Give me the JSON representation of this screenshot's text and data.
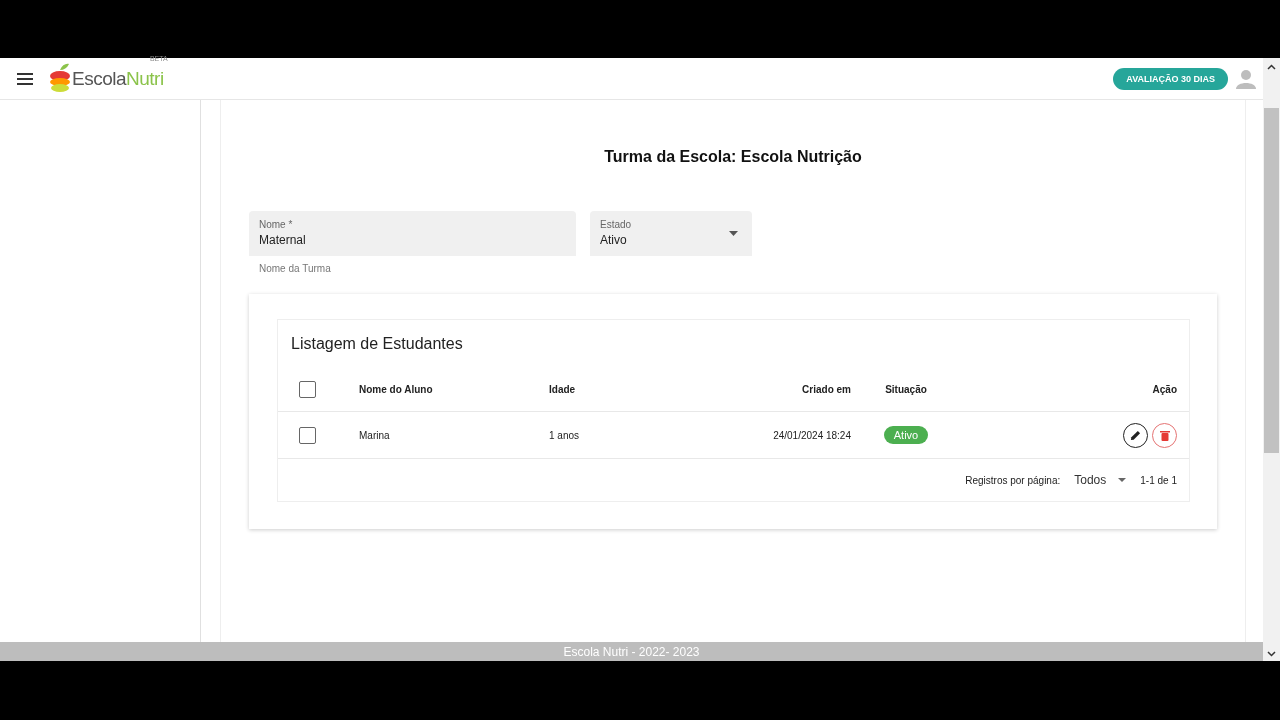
{
  "header": {
    "logo": {
      "name_part1": "Escola",
      "name_part2": "Nutri",
      "tag": "BETA"
    },
    "trial_button": "AVALIAÇÃO 30 DIAS"
  },
  "page_title": "Turma da Escola: Escola Nutrição",
  "form": {
    "name_field": {
      "label": "Nome *",
      "value": "Maternal",
      "helper": "Nome da Turma"
    },
    "status_select": {
      "label": "Estado",
      "value": "Ativo"
    }
  },
  "students": {
    "title": "Listagem de Estudantes",
    "select_all_checked": false,
    "columns": [
      {
        "label": "Nome do Aluno"
      },
      {
        "label": "Idade"
      },
      {
        "label": "Criado em"
      },
      {
        "label": "Situação"
      },
      {
        "label": "Ação"
      }
    ],
    "rows": [
      {
        "checked": false,
        "name": "Marina",
        "age": "1 anos",
        "created": "24/01/2024 18:24",
        "status": "Ativo",
        "color": "#4caf50"
      }
    ],
    "pagination": {
      "label": "Registros por página:",
      "per_page": "Todos",
      "range": "1-1 de 1"
    }
  },
  "footer": "Escola Nutri - 2022- 2023"
}
